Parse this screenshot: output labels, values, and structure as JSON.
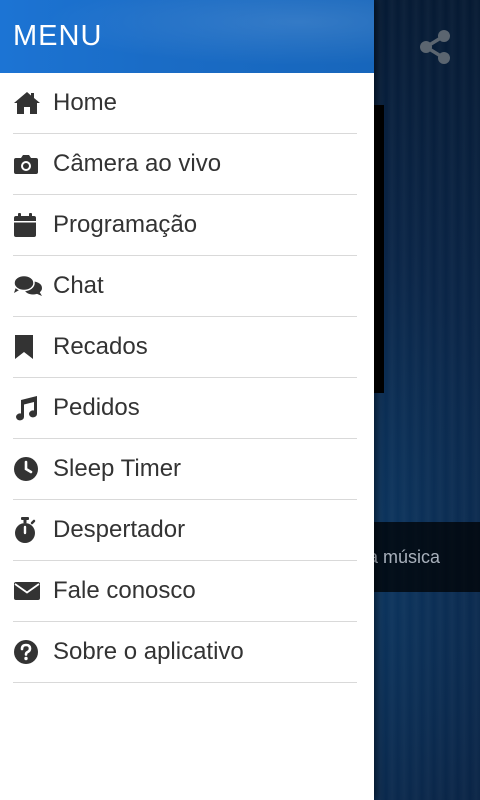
{
  "drawer": {
    "title": "MENU",
    "items": [
      {
        "label": "Home",
        "icon": "home-icon"
      },
      {
        "label": "Câmera ao vivo",
        "icon": "camera-icon"
      },
      {
        "label": "Programação",
        "icon": "calendar-icon"
      },
      {
        "label": "Chat",
        "icon": "chat-icon"
      },
      {
        "label": "Recados",
        "icon": "bookmark-icon"
      },
      {
        "label": "Pedidos",
        "icon": "music-note-icon"
      },
      {
        "label": "Sleep Timer",
        "icon": "clock-icon"
      },
      {
        "label": "Despertador",
        "icon": "stopwatch-icon"
      },
      {
        "label": "Fale conosco",
        "icon": "envelope-icon"
      },
      {
        "label": "Sobre o aplicativo",
        "icon": "question-circle-icon"
      }
    ]
  },
  "background": {
    "now_playing_text": "a música",
    "share_icon": "share-icon"
  },
  "colors": {
    "header": "#1c74d4",
    "icon": "#333333",
    "divider": "#d9d9d9"
  }
}
